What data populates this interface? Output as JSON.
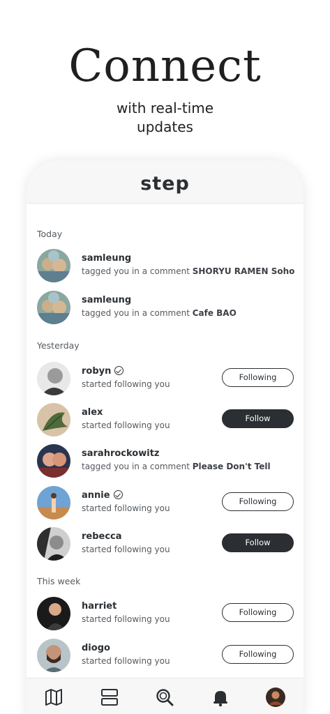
{
  "promo": {
    "title": "Connect",
    "subtitle_line1": "with real-time",
    "subtitle_line2": "updates"
  },
  "app": {
    "logo": "step"
  },
  "sections": {
    "today": "Today",
    "yesterday": "Yesterday",
    "this_week": "This week"
  },
  "notifications": [
    {
      "user": "samleung",
      "text": "tagged you in a comment ",
      "place": "SHORYU RAMEN Soho",
      "verified": false,
      "button": null
    },
    {
      "user": "samleung",
      "text": "tagged you in a comment ",
      "place": "Cafe BAO",
      "verified": false,
      "button": null
    },
    {
      "user": "robyn",
      "text": "started following you",
      "place": "",
      "verified": true,
      "button": "Following"
    },
    {
      "user": "alex",
      "text": "started following you",
      "place": "",
      "verified": false,
      "button": "Follow"
    },
    {
      "user": "sarahrockowitz",
      "text": "tagged you in a comment ",
      "place": "Please Don't Tell",
      "verified": false,
      "button": null
    },
    {
      "user": "annie",
      "text": "started following you",
      "place": "",
      "verified": true,
      "button": "Following"
    },
    {
      "user": "rebecca",
      "text": "started following you",
      "place": "",
      "verified": false,
      "button": "Follow"
    },
    {
      "user": "harriet",
      "text": "started following you",
      "place": "",
      "verified": false,
      "button": "Following"
    },
    {
      "user": "diogo",
      "text": "started following you",
      "place": "",
      "verified": false,
      "button": "Following"
    }
  ],
  "tabs": [
    "map-icon",
    "feed-icon",
    "search-icon",
    "notifications-bell-icon",
    "profile-avatar"
  ],
  "colors": {
    "dark": "#2b2f33",
    "muted": "#555a5f",
    "background": "#ffffff",
    "panel": "#f7f7f8"
  }
}
